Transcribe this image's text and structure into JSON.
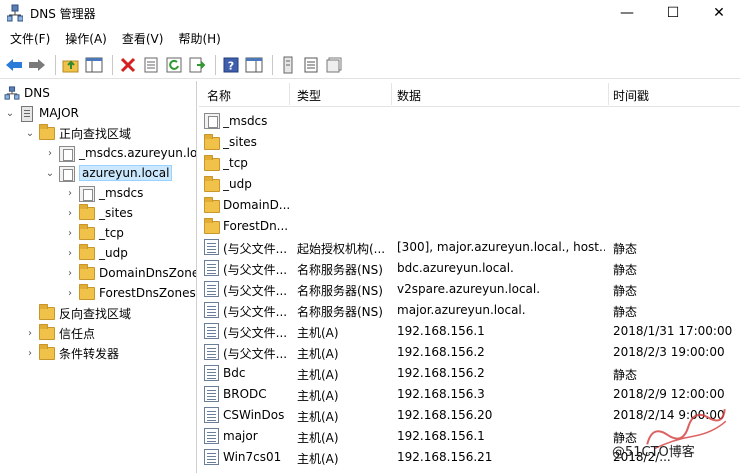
{
  "window": {
    "title": "DNS 管理器",
    "minimize": "—",
    "maximize": "☐",
    "close": "✕"
  },
  "menu": [
    "文件(F)",
    "操作(A)",
    "查看(V)",
    "帮助(H)"
  ],
  "toolbar": {
    "icons": [
      "back-icon",
      "forward-icon",
      "up-folder-icon",
      "show-hide-console-tree-icon",
      "delete-icon",
      "properties-icon",
      "refresh-icon",
      "export-list-icon",
      "help-icon",
      "show-action-pane-icon",
      "new-record-icon",
      "list-icon",
      "details-icon"
    ]
  },
  "tree": {
    "root": "DNS",
    "server": "MAJOR",
    "forward_zones": "正向查找区域",
    "msdcs_zone": "_msdcs.azureyun.lo",
    "azure_zone": "azureyun.local",
    "children": [
      "_msdcs",
      "_sites",
      "_tcp",
      "_udp",
      "DomainDnsZone",
      "ForestDnsZones"
    ],
    "reverse_zones": "反向查找区域",
    "trust_points": "信任点",
    "conditional_forwarders": "条件转发器"
  },
  "list": {
    "columns": [
      "名称",
      "类型",
      "数据",
      "时间戳"
    ],
    "rows": [
      {
        "name": "_msdcs",
        "type": "",
        "data": "",
        "timestamp": "",
        "icon": "zone"
      },
      {
        "name": "_sites",
        "type": "",
        "data": "",
        "timestamp": "",
        "icon": "folder"
      },
      {
        "name": "_tcp",
        "type": "",
        "data": "",
        "timestamp": "",
        "icon": "folder"
      },
      {
        "name": "_udp",
        "type": "",
        "data": "",
        "timestamp": "",
        "icon": "folder"
      },
      {
        "name": "DomainD...",
        "type": "",
        "data": "",
        "timestamp": "",
        "icon": "folder"
      },
      {
        "name": "ForestDn...",
        "type": "",
        "data": "",
        "timestamp": "",
        "icon": "folder"
      },
      {
        "name": "(与父文件...",
        "type": "起始授权机构(...",
        "data": "[300], major.azureyun.local., host...",
        "timestamp": "静态",
        "icon": "record"
      },
      {
        "name": "(与父文件...",
        "type": "名称服务器(NS)",
        "data": "bdc.azureyun.local.",
        "timestamp": "静态",
        "icon": "record"
      },
      {
        "name": "(与父文件...",
        "type": "名称服务器(NS)",
        "data": "v2spare.azureyun.local.",
        "timestamp": "静态",
        "icon": "record"
      },
      {
        "name": "(与父文件...",
        "type": "名称服务器(NS)",
        "data": "major.azureyun.local.",
        "timestamp": "静态",
        "icon": "record"
      },
      {
        "name": "(与父文件...",
        "type": "主机(A)",
        "data": "192.168.156.1",
        "timestamp": "2018/1/31 17:00:00",
        "icon": "record"
      },
      {
        "name": "(与父文件...",
        "type": "主机(A)",
        "data": "192.168.156.2",
        "timestamp": "2018/2/3 19:00:00",
        "icon": "record"
      },
      {
        "name": "Bdc",
        "type": "主机(A)",
        "data": "192.168.156.2",
        "timestamp": "静态",
        "icon": "record"
      },
      {
        "name": "BRODC",
        "type": "主机(A)",
        "data": "192.168.156.3",
        "timestamp": "2018/2/9 12:00:00",
        "icon": "record"
      },
      {
        "name": "CSWinDos",
        "type": "主机(A)",
        "data": "192.168.156.20",
        "timestamp": "2018/2/14 9:00:00",
        "icon": "record"
      },
      {
        "name": "major",
        "type": "主机(A)",
        "data": "192.168.156.1",
        "timestamp": "静态",
        "icon": "record"
      },
      {
        "name": "Win7cs01",
        "type": "主机(A)",
        "data": "192.168.156.21",
        "timestamp": "2018/2/...",
        "icon": "record"
      }
    ]
  },
  "watermark": "@51CTO博客"
}
